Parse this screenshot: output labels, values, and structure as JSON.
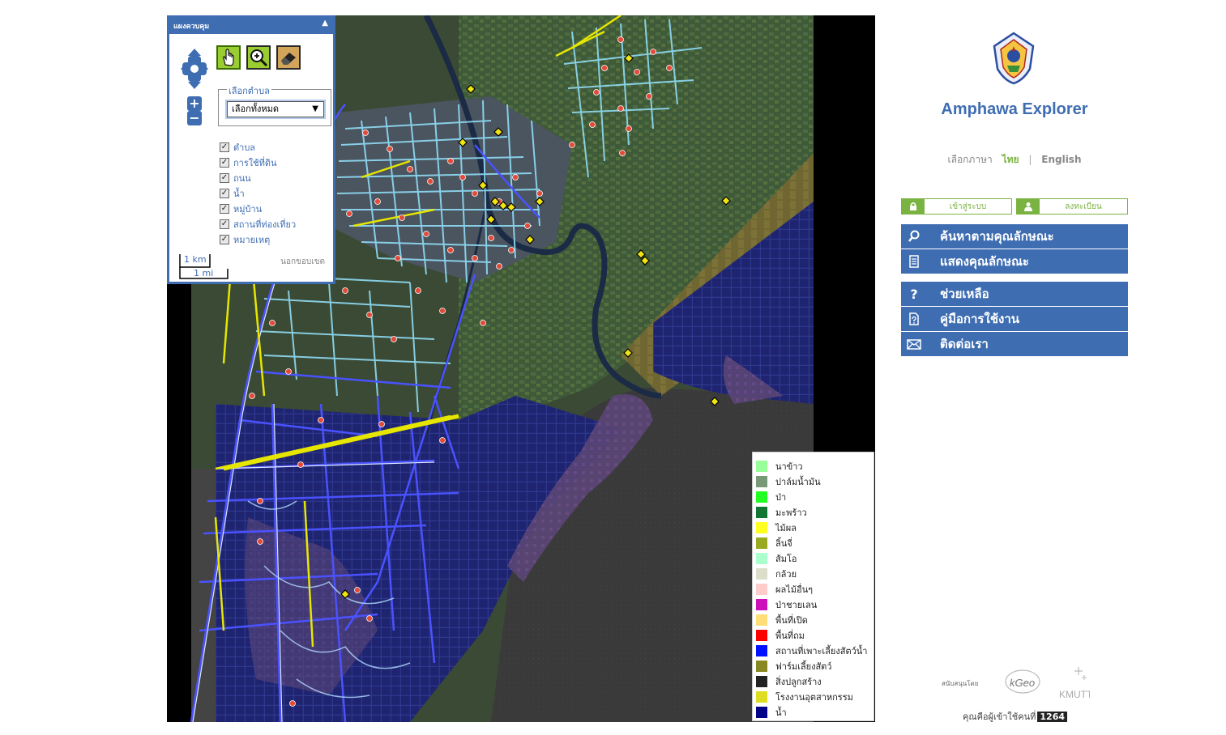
{
  "control_panel": {
    "title": "แผงควบคุม",
    "fieldset_label": "เลือกตำบล",
    "selected_tambon": "เลือกทั้งหมด",
    "layers": [
      {
        "label": "ตำบล",
        "checked": true
      },
      {
        "label": "การใช้ที่ดิน",
        "checked": true
      },
      {
        "label": "ถนน",
        "checked": true
      },
      {
        "label": "น้ำ",
        "checked": true
      },
      {
        "label": "หมู่บ้าน",
        "checked": true
      },
      {
        "label": "สถานที่ท่องเที่ยว",
        "checked": true
      },
      {
        "label": "หมายเหตุ",
        "checked": true
      }
    ],
    "scale_km": "1 km",
    "scale_mi": "1 mi",
    "outside_label": "นอกขอบเขต"
  },
  "legend": [
    {
      "label": "นาข้าว",
      "color": "#99ff99"
    },
    {
      "label": "ปาล์มน้ำมัน",
      "color": "#779977"
    },
    {
      "label": "ป่า",
      "color": "#22ff22"
    },
    {
      "label": "มะพร้าว",
      "color": "#117733"
    },
    {
      "label": "ไม้ผล",
      "color": "#ffff22"
    },
    {
      "label": "ลิ้นจี่",
      "color": "#99aa22"
    },
    {
      "label": "ส้มโอ",
      "color": "#aaffcc"
    },
    {
      "label": "กล้วย",
      "color": "#ddddcc"
    },
    {
      "label": "ผลไม้อื่นๆ",
      "color": "#ffcccc"
    },
    {
      "label": "ป่าชายเลน",
      "color": "#cc11bb"
    },
    {
      "label": "พื้นที่เปิด",
      "color": "#ffdd77"
    },
    {
      "label": "พื้นที่ถม",
      "color": "#ff0000"
    },
    {
      "label": "สถานที่เพาะเลี้ยงสัตว์น้ำ",
      "color": "#0011ff"
    },
    {
      "label": "ฟาร์มเลี้ยงสัตว์",
      "color": "#888822"
    },
    {
      "label": "สิ่งปลูกสร้าง",
      "color": "#222222"
    },
    {
      "label": "โรงงานอุตสาหกรรม",
      "color": "#dddd22"
    },
    {
      "label": "น้ำ",
      "color": "#000088"
    }
  ],
  "sidebar": {
    "app_title": "Amphawa Explorer",
    "lang_label": "เลือกภาษา",
    "lang_th": "ไทย",
    "lang_sep": "|",
    "lang_en": "English",
    "login_label": "เข้าสู่ระบบ",
    "register_label": "ลงทะเบียน",
    "menu": [
      {
        "label": "ค้นหาตามคุณลักษณะ",
        "icon": "search-icon"
      },
      {
        "label": "แสดงคุณลักษณะ",
        "icon": "document-icon"
      },
      {
        "label": "ช่วยเหลือ",
        "icon": "help-icon"
      },
      {
        "label": "คู่มือการใช้งาน",
        "icon": "manual-icon"
      },
      {
        "label": "ติดต่อเรา",
        "icon": "mail-icon"
      }
    ],
    "support_label": "สนับสนุนโดย",
    "kgeo_text": "kGeo",
    "kmutt_text": "KMUTT",
    "visitor_label": "คุณคือผู้เข้าใช้คนที่",
    "visitor_count": "1264"
  }
}
